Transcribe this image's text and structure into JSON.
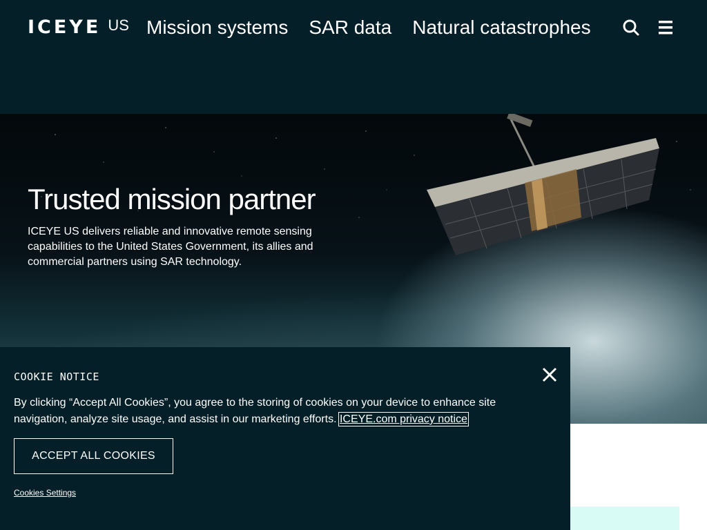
{
  "header": {
    "logo_text": "ICEYE",
    "logo_suffix": "US",
    "nav": [
      {
        "label": "Mission systems"
      },
      {
        "label": "SAR data"
      },
      {
        "label": "Natural catastrophes"
      }
    ],
    "icons": {
      "search": "search-icon",
      "menu": "hamburger-menu-icon"
    }
  },
  "hero": {
    "title": "Trusted mission partner",
    "description": "ICEYE US delivers reliable and innovative remote sensing capabilities to the United States Government, its allies and commercial partners using SAR technology."
  },
  "cookie": {
    "title": "COOKIE NOTICE",
    "text": "By clicking “Accept All Cookies”, you agree to the storing of cookies on your device to enhance site navigation, analyze site usage, and assist in our marketing efforts.",
    "privacy_link": "ICEYE.com privacy notice",
    "accept_button": "ACCEPT ALL COOKIES",
    "settings_link": "Cookies Settings",
    "close_icon": "close-icon"
  },
  "colors": {
    "header_bg": "#051f28",
    "cookie_bg": "#051f28",
    "accent_mint": "#d8fcf5"
  }
}
